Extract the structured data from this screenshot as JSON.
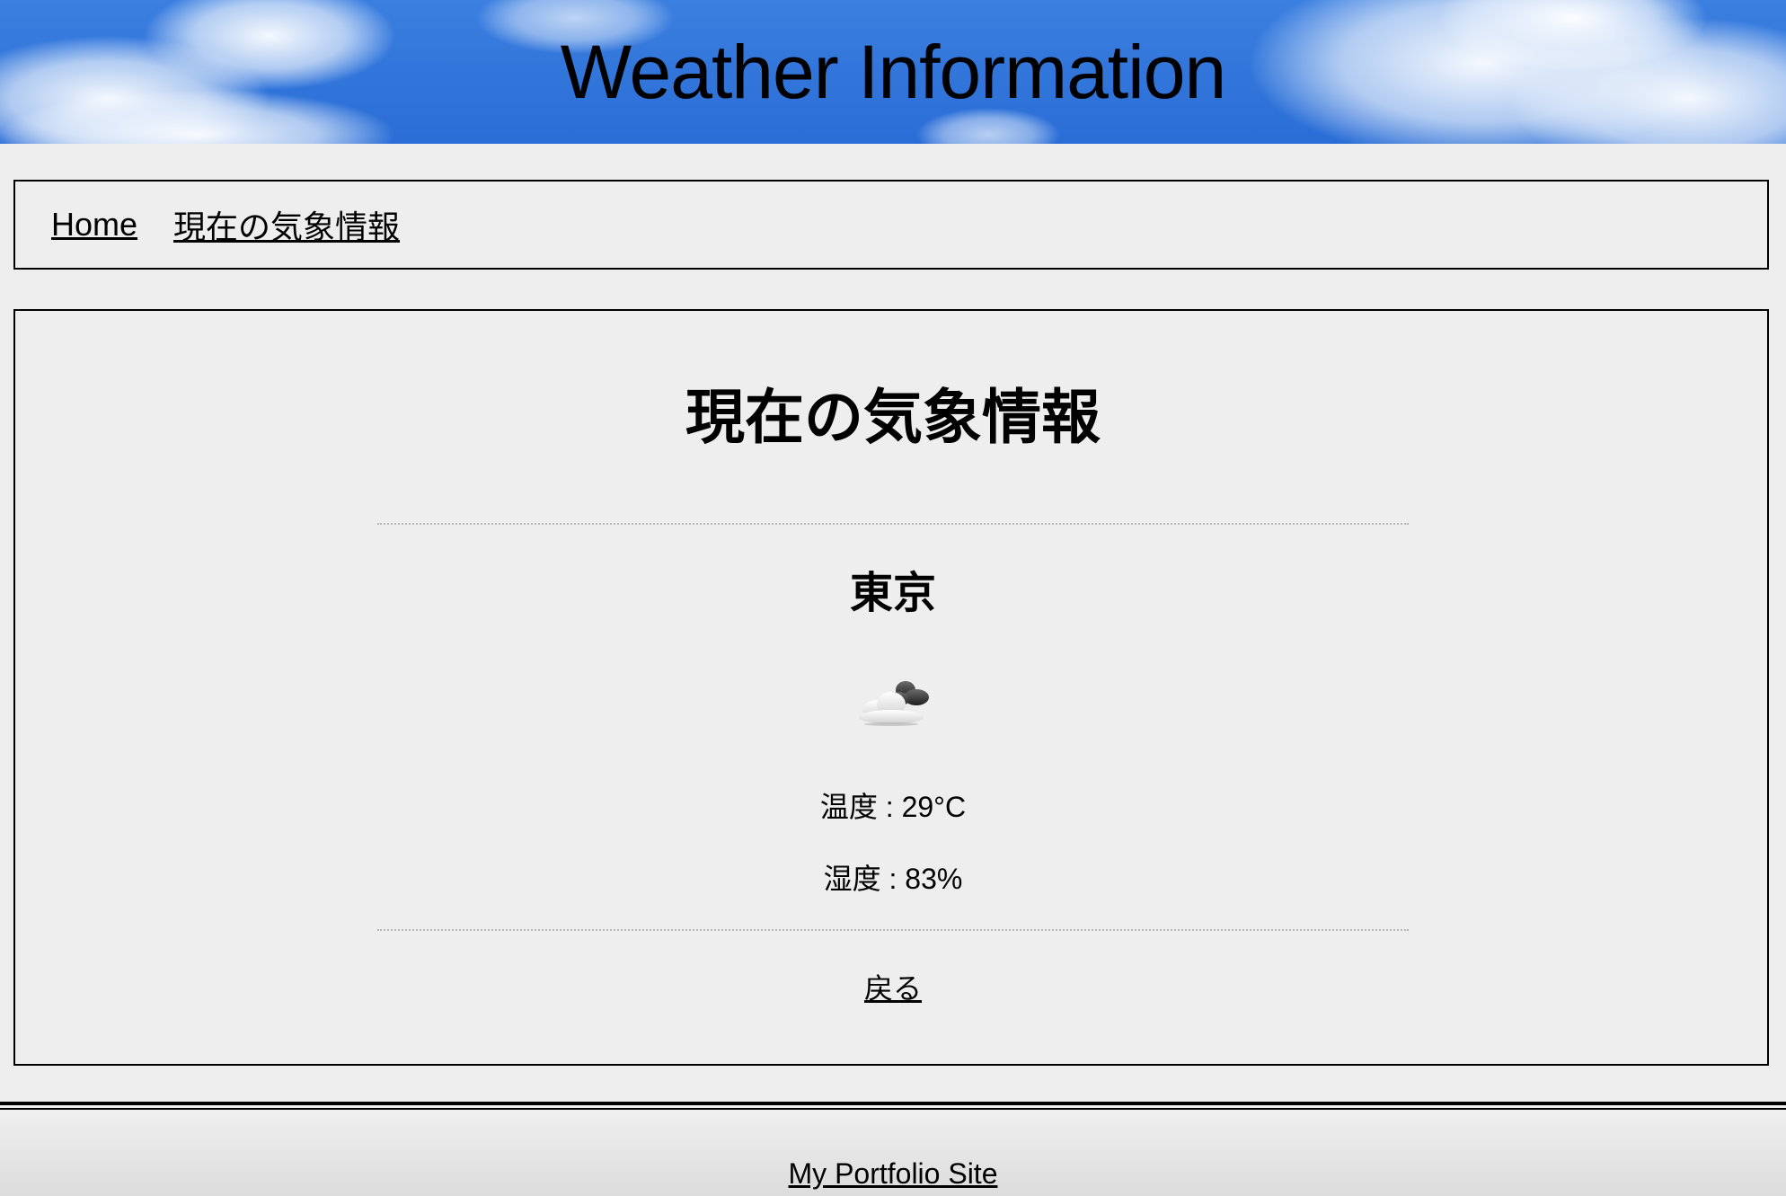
{
  "header": {
    "title": "Weather Information"
  },
  "breadcrumb": {
    "items": [
      {
        "label": "Home"
      },
      {
        "label": "現在の気象情報"
      }
    ]
  },
  "main": {
    "title": "現在の気象情報",
    "city": "東京",
    "weather_icon": "cloud-sun-icon",
    "temperature_text": "温度 : 29°C",
    "humidity_text": "湿度 : 83%",
    "back_label": "戻る"
  },
  "footer": {
    "link_label": "My Portfolio Site"
  },
  "colors": {
    "header_sky": "#2f73d8",
    "background": "#eeeeee",
    "border": "#000000",
    "divider": "#b5b5b5"
  }
}
